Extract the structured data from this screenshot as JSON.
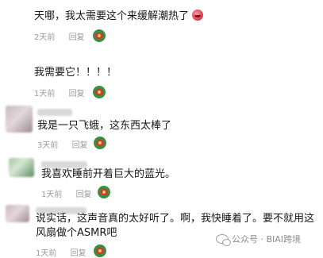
{
  "comments": [
    {
      "text": "天哪，我太需要这个来缓解潮热了",
      "time": "2天前",
      "reply": "回复",
      "emoji": "face-with-open-mouth-emoji",
      "reaction_icon": "watermelon-reaction-icon"
    },
    {
      "text": "我需要它！！！！",
      "time": "1天前",
      "reply": "回复",
      "reaction_icon": "watermelon-reaction-icon"
    },
    {
      "text": "我是一只飞蛾，这东西太棒了",
      "time": "3天前",
      "reply": "回复",
      "reaction_icon": "watermelon-reaction-icon"
    },
    {
      "text": "我喜欢睡前开着巨大的蓝光。",
      "time": "1天前",
      "reply": "回复",
      "reaction_icon": "watermelon-reaction-icon"
    },
    {
      "text_line1": "说实话，这声音真的太好听了。啊，我快睡着了。要不就用这",
      "text_line2": "风扇做个ASMR吧",
      "time": "1天前",
      "reply": "回复",
      "reaction_icon": "watermelon-reaction-icon"
    }
  ],
  "watermark": {
    "text": "公众号 · BIAI跨境",
    "icon": "wechat-icon"
  },
  "colors": {
    "text": "#161616",
    "meta": "#9a9a9a",
    "background": "#ffffff"
  }
}
